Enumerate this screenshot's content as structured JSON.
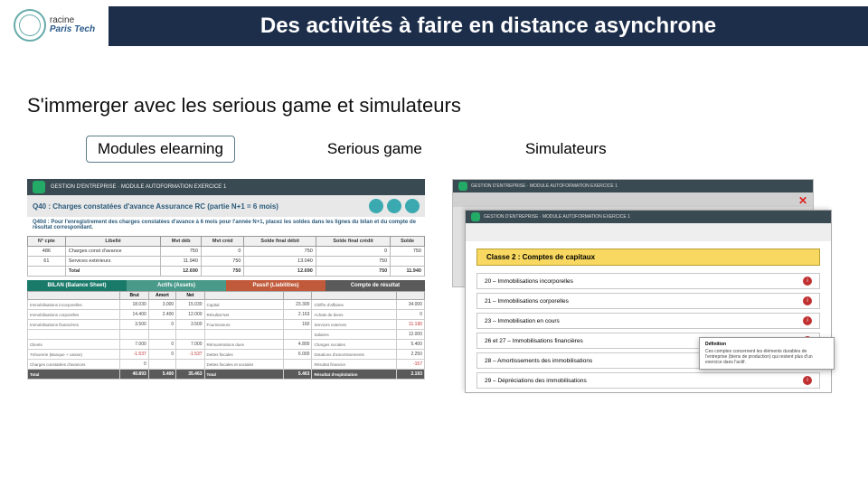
{
  "header": {
    "logo_top": "racine",
    "logo_brand": "Paris Tech",
    "title": "Des activités à faire en distance asynchrone"
  },
  "subtitle": "S'immerger avec les serious game et simulateurs",
  "tabs": {
    "t1": "Modules elearning",
    "t2": "Serious game",
    "t3": "Simulateurs"
  },
  "module": {
    "course_tag": "GESTION D'ENTREPRISE · MODULE AUTOFORMATION EXERCICE 1",
    "q_title": "Q40 : Charges constatées d'avance Assurance RC (partie N+1 = 6 mois)",
    "q_desc": "Q40d : Pour l'enregistrement des charges constatées d'avance à 6 mois pour l'année N+1, placez les soldes dans les lignes du bilan et du compte de résultat correspondant.",
    "top_headers": [
      "N° cpte",
      "Libellé",
      "Mvt déb",
      "Mvt créd",
      "Solde final débit",
      "Solde final crédit",
      "Solde"
    ],
    "top_rows": [
      [
        "486",
        "Charges const d'avance",
        "750",
        "0",
        "750",
        "0",
        "750"
      ],
      [
        "61",
        "Services extérieurs",
        "11.940",
        "750",
        "13.040",
        "750",
        ""
      ],
      [
        "",
        "Total",
        "12.690",
        "750",
        "12.690",
        "750",
        "11.940"
      ]
    ],
    "bilan_title": "BILAN (Balance Sheet)",
    "bilan_groups": [
      "Actifs (Assets)",
      "",
      "Passif (Liabilities)",
      "Compte de résultat"
    ],
    "bilan_headers": [
      "",
      "Brut",
      "Amort",
      "Net",
      "",
      "",
      "",
      ""
    ],
    "bilan_rows": [
      [
        "Immobilisations incorporelles",
        "18.030",
        "3.000",
        "15.030",
        "Capital",
        "23.300",
        "Chiffre d'affaires",
        "34.000"
      ],
      [
        "Immobilisations corporelles",
        "14.400",
        "2.400",
        "12.000",
        "Résultat Net",
        "2.163",
        "Achats de biens",
        "0"
      ],
      [
        "Immobilisations financières",
        "3.500",
        "0",
        "3.500",
        "Fournisseurs",
        "160",
        "Services externes",
        "11.190"
      ],
      [
        "",
        "",
        "",
        "",
        "",
        "",
        "Salaires",
        "12.000"
      ],
      [
        "Clients",
        "7.000",
        "0",
        "7.000",
        "Rémunérations dues",
        "4.800",
        "Charges sociales",
        "5.400"
      ],
      [
        "Trésorerie (Banque + caisse)",
        "-1.537",
        "0",
        "-1.537",
        "Dettes fiscales",
        "6.000",
        "Dotations d'amortissements",
        "2.250"
      ],
      [
        "Charges constatées d'avances",
        "0",
        "",
        "",
        "Dettes fiscales et sociales",
        "",
        "Résultat financier",
        "-157"
      ],
      [
        "Total",
        "40.893",
        "5.400",
        "35.463",
        "Total",
        "5.463",
        "Résultat d'exploitation",
        "2.193"
      ]
    ]
  },
  "sim": {
    "bar_text": "GESTION D'ENTREPRISE · MODULE AUTOFORMATION EXERCICE 1",
    "class_label": "Classe 2 : Comptes de capitaux",
    "rows": [
      "20 – Immobilisations incorporelles",
      "21 – Immobilisations corporelles",
      "23 – Immobilisation en cours",
      "26 et 27 – Immobilisations financières",
      "28 – Amortissements des immobilisations",
      "29 – Dépréciations des immobilisations"
    ],
    "tooltip_h": "Définition",
    "tooltip_b": "Ces comptes concernent les éléments durables de l'entreprise (biens de production) qui restent plus d'un exercice dans l'actif."
  }
}
